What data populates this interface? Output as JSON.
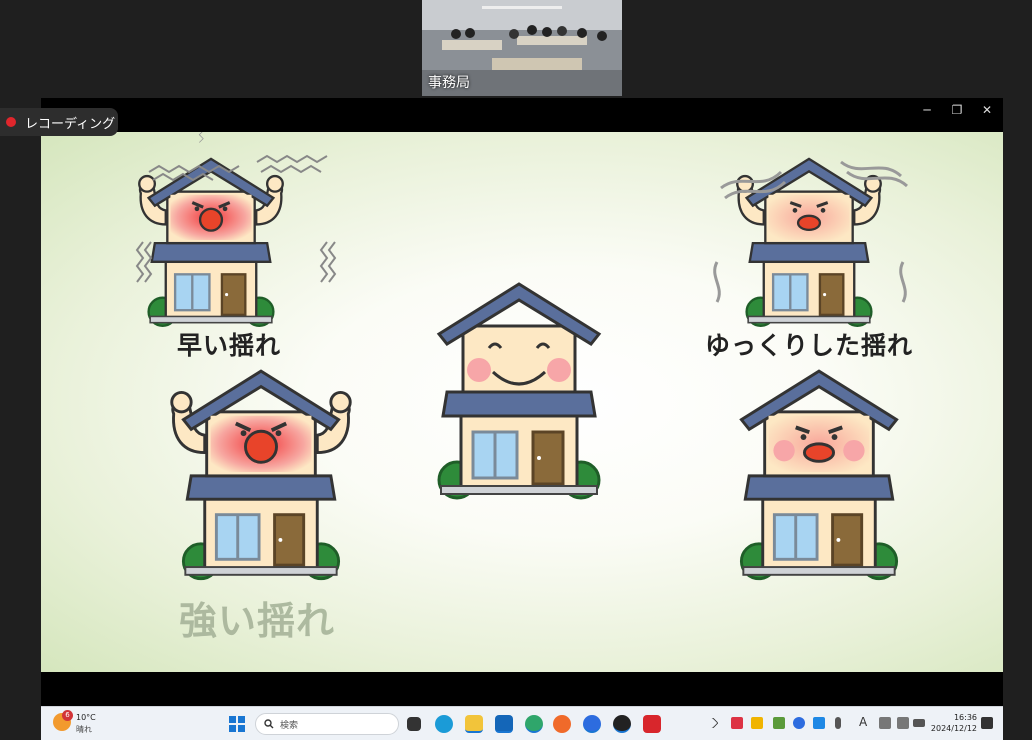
{
  "participant": {
    "name": "事務局"
  },
  "recording": {
    "label": "レコーディング"
  },
  "window_controls": {
    "minimize": "─",
    "restore": "❐",
    "close": "✕"
  },
  "slide": {
    "label_fast": "早い揺れ",
    "label_slow": "ゆっくりした揺れ",
    "label_strong": "強い揺れ"
  },
  "taskbar": {
    "weather_temp": "10°C",
    "weather_condition": "晴れ",
    "weather_badge": "6",
    "search_placeholder": "検索",
    "ime_indicator": "A",
    "time": "16:36",
    "date": "2024/12/12",
    "apps": [
      "task-view-icon",
      "teams-icon",
      "file-explorer-icon",
      "outlook-icon",
      "edge-icon",
      "firefox-icon",
      "zoom-icon",
      "media-player-icon",
      "acrobat-icon"
    ]
  },
  "colors": {
    "accent": "#1976d2",
    "record_red": "#e0262c",
    "roof": "#5a6f9c",
    "wall": "#fde8c4"
  }
}
